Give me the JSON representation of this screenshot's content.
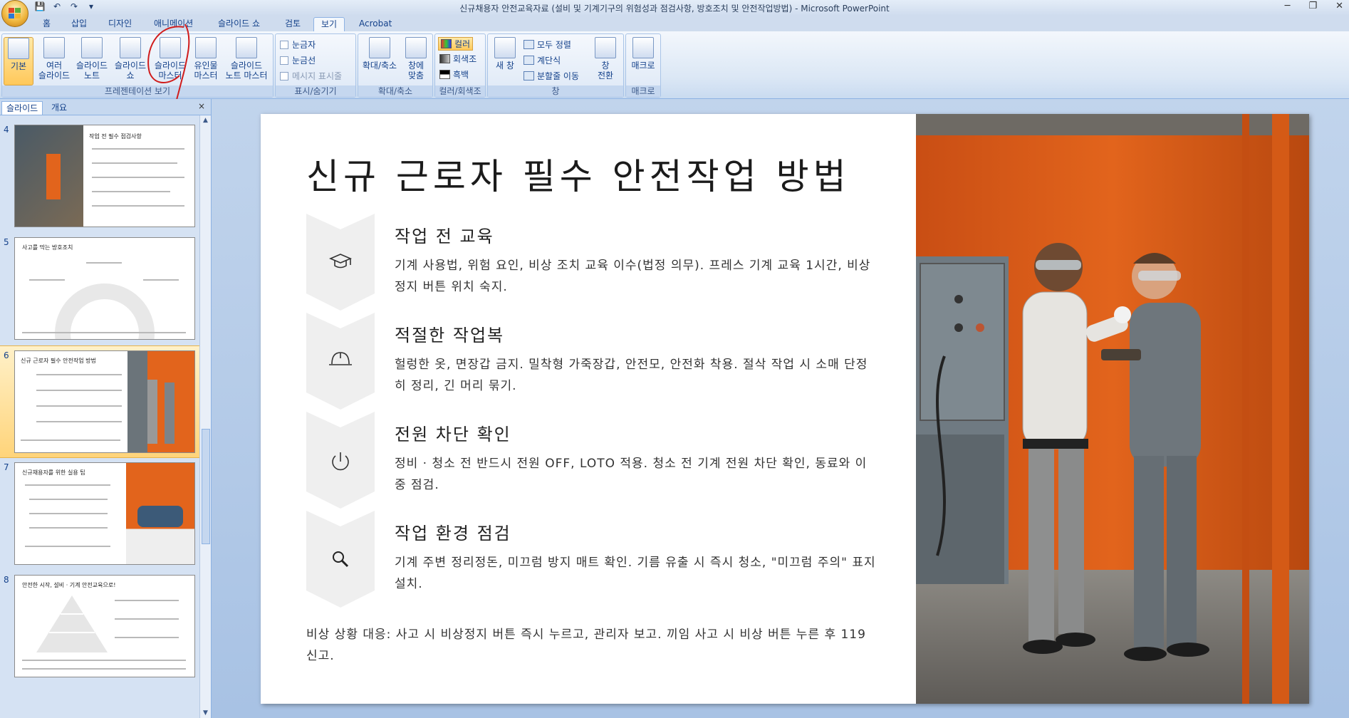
{
  "window": {
    "title": "신규채용자 안전교육자료 (설비 및 기계기구의 위험성과 점검사항, 방호조치 및 안전작업방법) - Microsoft PowerPoint",
    "min": "─",
    "max": "❐",
    "close": "✕"
  },
  "qat": {
    "save": "💾",
    "undo": "↶",
    "redo": "↷",
    "more": "▾"
  },
  "tabs": [
    "홈",
    "삽입",
    "디자인",
    "애니메이션",
    "슬라이드 쇼",
    "검토",
    "보기",
    "Acrobat"
  ],
  "ribbon": {
    "presentation_views": {
      "label": "프레젠테이션 보기",
      "normal": "기본",
      "sorter_1": "여러",
      "sorter_2": "슬라이드",
      "notes_1": "슬라이드",
      "notes_2": "노트",
      "show_1": "슬라이드",
      "show_2": "쇼",
      "master_1": "슬라이드",
      "master_2": "마스터",
      "handout_1": "유인물",
      "handout_2": "마스터",
      "notesmaster_1": "슬라이드",
      "notesmaster_2": "노트 마스터"
    },
    "show_hide": {
      "label": "표시/숨기기",
      "ruler": "눈금자",
      "gridlines": "눈금선",
      "message_bar": "메시지 표시줄"
    },
    "zoom": {
      "label": "확대/축소",
      "zoom": "확대/축소",
      "fit_1": "창에",
      "fit_2": "맞춤"
    },
    "color": {
      "label": "컬러/회색조",
      "color": "컬러",
      "grayscale": "회색조",
      "bw": "흑백"
    },
    "window": {
      "label": "창",
      "new_1": "새 창",
      "arrange": "모두 정렬",
      "cascade": "계단식",
      "move_split": "분할줄 이동",
      "switch_1": "창",
      "switch_2": "전환"
    },
    "macro": {
      "label": "매크로",
      "macros": "매크로"
    }
  },
  "panel": {
    "tab_slides": "슬라이드",
    "tab_outline": "개요",
    "close": "×",
    "thumbs": [
      {
        "num": "4",
        "title": "작업 전 필수 점검사항"
      },
      {
        "num": "5",
        "title": "사고를 막는 방호조치"
      },
      {
        "num": "6",
        "title": "신규 근로자 필수 안전작업 방법"
      },
      {
        "num": "7",
        "title": "신규채용자를 위한 실용 팁"
      },
      {
        "num": "8",
        "title": "안전한 시작, 설비 · 기계 안전교육으로!"
      }
    ]
  },
  "slide": {
    "title": "신규 근로자 필수 안전작업 방법",
    "items": [
      {
        "icon": "graduation-cap-icon",
        "title": "작업 전 교육",
        "desc": "기계 사용법, 위험 요인, 비상 조치 교육 이수(법정 의무). 프레스 기계 교육 1시간, 비상정지 버튼 위치 숙지."
      },
      {
        "icon": "hard-hat-icon",
        "title": "적절한 작업복",
        "desc": "헐렁한 옷, 면장갑 금지. 밀착형 가죽장갑, 안전모, 안전화 착용. 절삭 작업 시 소매 단정히 정리, 긴 머리 묶기."
      },
      {
        "icon": "power-icon",
        "title": "전원 차단 확인",
        "desc": "정비 · 청소 전 반드시 전원 OFF, LOTO 적용. 청소 전 기계 전원 차단 확인, 동료와 이중 점검."
      },
      {
        "icon": "search-icon",
        "title": "작업 환경 점검",
        "desc": "기계 주변 정리정돈, 미끄럼 방지 매트 확인. 기름 유출 시 즉시 청소, \"미끄럼 주의\" 표지 설치."
      }
    ],
    "footer": "비상 상황 대응: 사고 시 비상정지 버튼 즉시 누르고, 관리자 보고. 끼임 사고 시 비상 버튼 누른 후 119 신고."
  },
  "colors": {
    "accent_orange": "#e2641c",
    "ribbon_blue": "#15428b"
  }
}
